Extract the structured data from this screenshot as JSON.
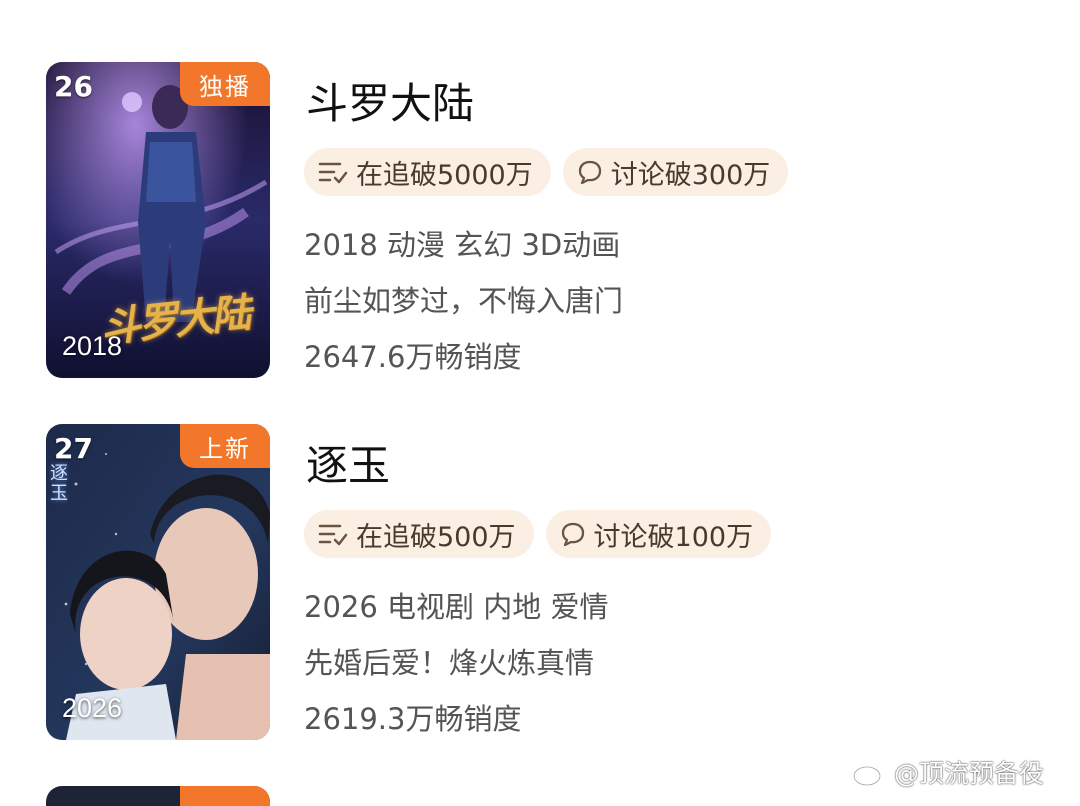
{
  "items": [
    {
      "rank": "26",
      "badge": "独播",
      "year_overlay": "2018",
      "poster_logo": "斗罗大陆",
      "title": "斗罗大陆",
      "follow_tag": "在追破5000万",
      "discuss_tag": "讨论破300万",
      "meta": "2018 动漫 玄幻 3D动画",
      "tagline": "前尘如梦过，不悔入唐门",
      "sales": "2647.6万畅销度"
    },
    {
      "rank": "27",
      "badge": "上新",
      "year_overlay": "2026",
      "poster_logo": "逐玉",
      "title": "逐玉",
      "follow_tag": "在追破500万",
      "discuss_tag": "讨论破100万",
      "meta": "2026 电视剧 内地 爱情",
      "tagline": "先婚后爱！烽火炼真情",
      "sales": "2619.3万畅销度"
    }
  ],
  "icons": {
    "follow": "list-check-icon",
    "discuss": "chat-bubble-icon"
  },
  "colors": {
    "badge": "#f2772a",
    "tag_bg": "#fbeee2"
  },
  "watermark": "@顶流预备役"
}
